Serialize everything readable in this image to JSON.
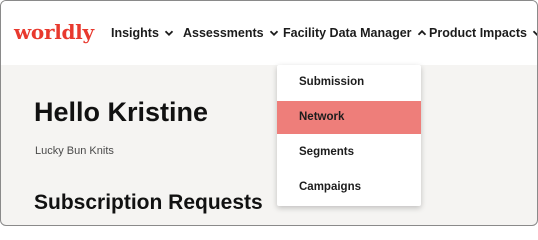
{
  "brand": {
    "logo_text": "worldly",
    "accent_color": "#e8392e"
  },
  "nav": {
    "items": [
      {
        "label": "Insights",
        "icon": "chevron-down-icon"
      },
      {
        "label": "Assessments",
        "icon": "chevron-down-icon"
      },
      {
        "label": "Facility Data Manager",
        "icon": "chevron-up-icon",
        "expanded": true
      },
      {
        "label": "Product Impacts",
        "icon": "chevron-down-icon"
      }
    ]
  },
  "dropdown": {
    "items": [
      {
        "label": "Submission"
      },
      {
        "label": "Network",
        "active": true,
        "highlight_color": "#ee7e7a"
      },
      {
        "label": "Segments"
      },
      {
        "label": "Campaigns"
      }
    ]
  },
  "main": {
    "greeting": "Hello Kristine",
    "company": "Lucky Bun Knits",
    "section_title": "Subscription Requests"
  }
}
